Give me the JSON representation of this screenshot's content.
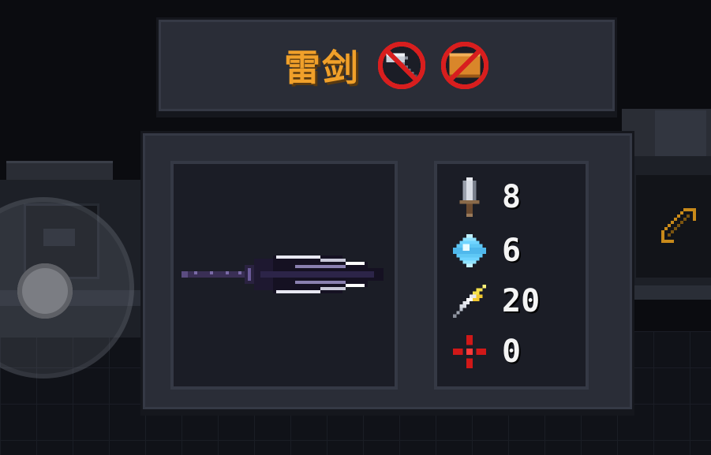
{
  "weapon": {
    "name": "雷剑",
    "restrictions": [
      {
        "icon": "no-hammer-icon"
      },
      {
        "icon": "no-crate-icon"
      }
    ],
    "sprite": "dark-spear-icon"
  },
  "stats": {
    "damage": {
      "icon": "sword-icon",
      "value": "8"
    },
    "energy": {
      "icon": "diamond-icon",
      "value": "6"
    },
    "crit": {
      "icon": "lightning-feather-icon",
      "value": "20"
    },
    "spread": {
      "icon": "crosshair-icon",
      "value": "0"
    }
  },
  "hud": {
    "joystick": "virtual-joystick",
    "side_weapon_icon": "bow-icon"
  },
  "colors": {
    "title_text": "#f0a02a",
    "panel_bg": "#2a2d37",
    "frame_bg": "#1b1d26",
    "ban_red": "#e02020"
  }
}
